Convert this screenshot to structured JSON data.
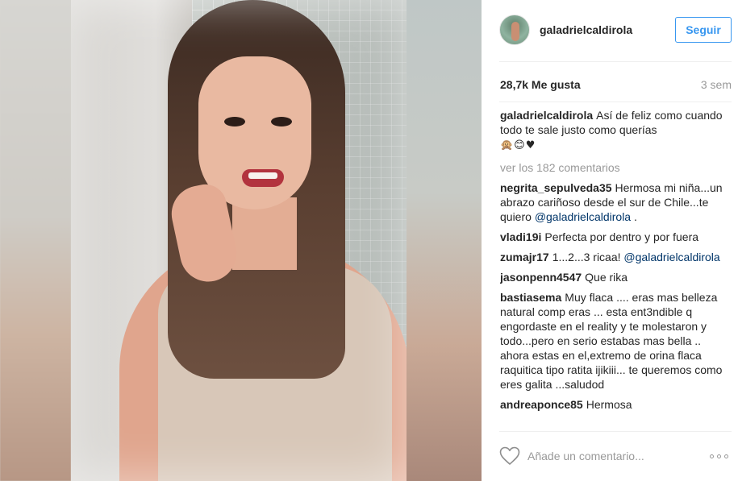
{
  "post": {
    "username": "galadrielcaldirola",
    "follow_label": "Seguir",
    "likes": "28,7k Me gusta",
    "time": "3 sem",
    "caption_user": "galadrielcaldirola",
    "caption_text": "Así de feliz como cuando todo te sale justo como querías",
    "caption_emojis": "🙊😊♥",
    "view_all": "ver los 182 comentarios",
    "comment_placeholder": "Añade un comentario...",
    "photo_description_icon": "selfie-photo"
  },
  "comments": [
    {
      "user": "negrita_sepulveda35",
      "text": "Hermosa mi niña...un abrazo cariñoso desde el sur de Chile...te quiero ",
      "mention": "@galadrielcaldirola",
      "after": " ."
    },
    {
      "user": "vladi19i",
      "text": "Perfecta por dentro y por fuera",
      "mention": "",
      "after": ""
    },
    {
      "user": "zumajr17",
      "text": "1...2...3 ricaa! ",
      "mention": "@galadrielcaldirola",
      "after": ""
    },
    {
      "user": "jasonpenn4547",
      "text": "Que rika",
      "mention": "",
      "after": ""
    },
    {
      "user": "bastiasema",
      "text": "Muy flaca .... eras mas belleza natural comp eras ... esta ent3ndible q engordaste en el reality y te molestaron y todo...pero en serio estabas mas bella .. ahora estas en el,extremo de orina flaca raquitica tipo ratita ijikiii... te queremos como eres galita ...saludod",
      "mention": "",
      "after": ""
    },
    {
      "user": "andreaponce85",
      "text": "Hermosa",
      "mention": "",
      "after": ""
    }
  ],
  "colors": {
    "accent": "#3897f0",
    "text": "#262626",
    "muted": "#999999",
    "mention": "#003569"
  }
}
